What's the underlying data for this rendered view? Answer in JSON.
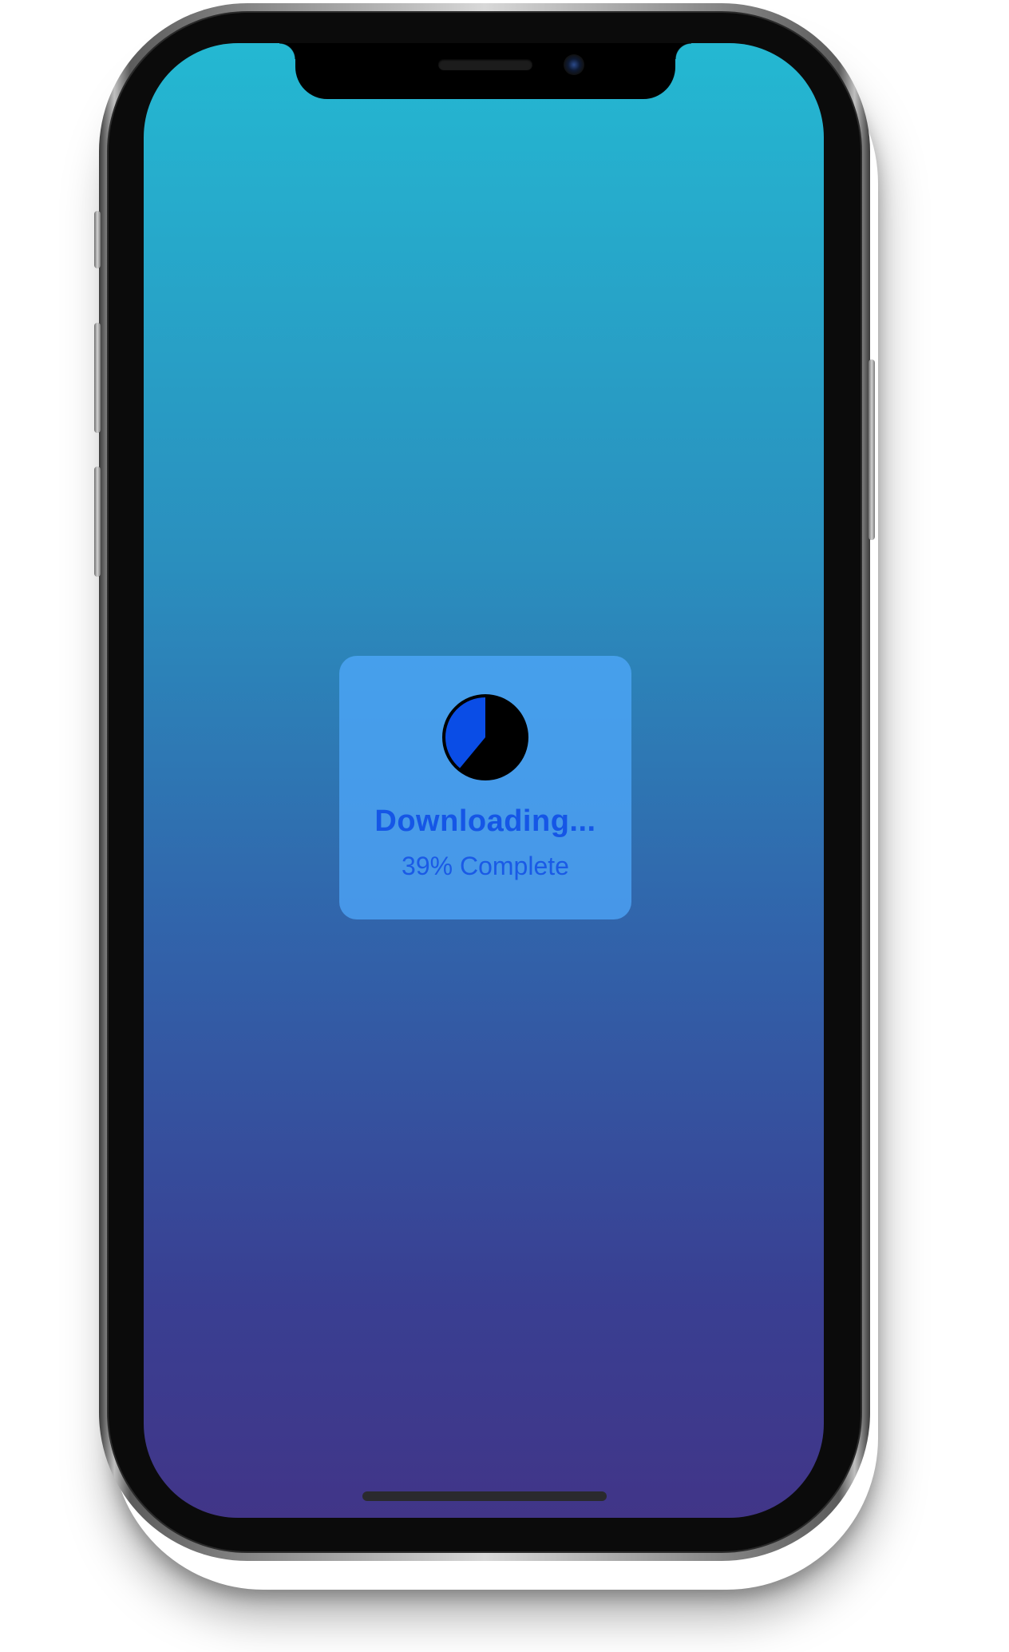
{
  "device": {
    "notch": {
      "speaker_icon": "speaker-grille-icon",
      "camera_icon": "front-camera-icon"
    }
  },
  "screen": {
    "background_top": "#24b8d2",
    "background_bottom": "#413588"
  },
  "download_hud": {
    "progress_icon": "pie-progress-icon",
    "progress_fraction": 0.39,
    "progress_fill_color": "#0a4de6",
    "title": "Downloading...",
    "status": "39% Complete"
  },
  "home_indicator": {
    "icon": "home-indicator-bar"
  }
}
